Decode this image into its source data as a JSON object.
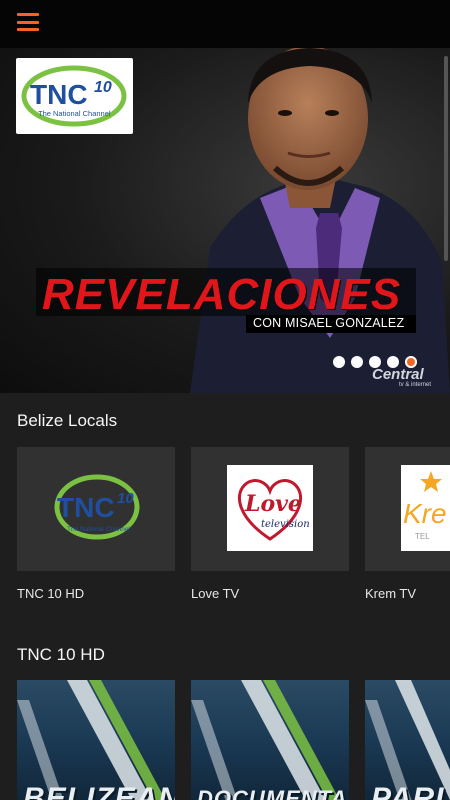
{
  "hero": {
    "logo_text": "TNC10",
    "logo_sub": "The National Channel",
    "title": "REVELACIONES",
    "subtitle": "CON MISAEL GONZALEZ",
    "watermark": "Central",
    "watermark_sub": "tv & internet",
    "slides": 5,
    "active_slide": 5
  },
  "sections": [
    {
      "title": "Belize Locals",
      "items": [
        {
          "label": "TNC 10 HD"
        },
        {
          "label": "Love TV"
        },
        {
          "label": "Krem TV"
        }
      ]
    },
    {
      "title": "TNC 10 HD",
      "items": [
        {
          "poster_text": "BELIZEAN"
        },
        {
          "poster_text": "DOCUMENTARIES"
        },
        {
          "poster_text": "PARLI"
        }
      ]
    }
  ],
  "logos": {
    "tnc_main": "TNC",
    "tnc_num": "10",
    "tnc_sub": "The National Channel",
    "love_main": "Love",
    "love_sub": "television",
    "krem_main": "Kre",
    "krem_sub": "TEL"
  },
  "colors": {
    "accent": "#f26522",
    "title_red": "#e0161b"
  }
}
